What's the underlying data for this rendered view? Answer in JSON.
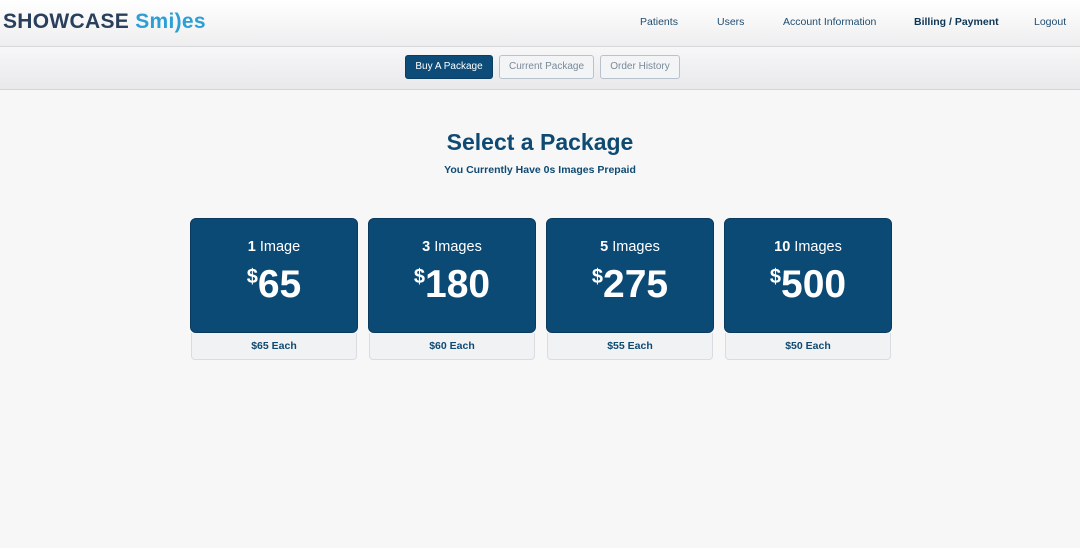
{
  "header": {
    "logo_part1": "SHOWCASE",
    "logo_part2": "Smi)es",
    "nav": [
      {
        "label": "Patients"
      },
      {
        "label": "Users"
      },
      {
        "label": "Account Information"
      },
      {
        "label": "Billing / Payment",
        "active": true
      },
      {
        "label": "Logout"
      }
    ]
  },
  "subnav": {
    "buy_label": "Buy A Package",
    "current_label": "Current Package",
    "history_label": "Order History"
  },
  "main": {
    "title": "Select a Package",
    "subtitle": "You Currently Have 0s Images Prepaid"
  },
  "packages": [
    {
      "count": "1",
      "unit": "Image",
      "currency": "$",
      "price": "65",
      "per_image": "$65 Each"
    },
    {
      "count": "3",
      "unit": "Images",
      "currency": "$",
      "price": "180",
      "per_image": "$60 Each"
    },
    {
      "count": "5",
      "unit": "Images",
      "currency": "$",
      "price": "275",
      "per_image": "$55 Each"
    },
    {
      "count": "10",
      "unit": "Images",
      "currency": "$",
      "price": "500",
      "per_image": "$50 Each"
    }
  ],
  "colors": {
    "brand_navy": "#0c4a76",
    "logo_blue": "#2d9fd6",
    "background": "#f7f7f8"
  }
}
